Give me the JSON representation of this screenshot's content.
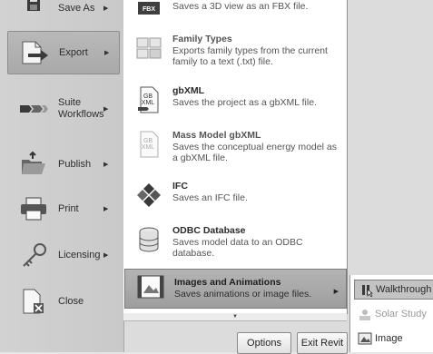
{
  "left_menu": {
    "items": [
      {
        "label": "Save As",
        "icon": "save-as-icon",
        "has_arrow": true
      },
      {
        "label": "Export",
        "icon": "export-icon",
        "has_arrow": true,
        "active": true
      },
      {
        "label": "Suite Workflows",
        "icon": "suite-workflows-icon",
        "has_arrow": true
      },
      {
        "label": "Publish",
        "icon": "publish-icon",
        "has_arrow": true
      },
      {
        "label": "Print",
        "icon": "print-icon",
        "has_arrow": true
      },
      {
        "label": "Licensing",
        "icon": "licensing-key-icon",
        "has_arrow": true
      },
      {
        "label": "Close",
        "icon": "close-document-icon",
        "has_arrow": false
      }
    ]
  },
  "export_menu": {
    "items": [
      {
        "title": "",
        "desc": "Saves a 3D view as an FBX file.",
        "icon": "fbx-icon"
      },
      {
        "title": "Family Types",
        "desc": "Exports family types from the current family to a text (.txt) file.",
        "icon": "family-types-icon"
      },
      {
        "title": "gbXML",
        "desc": "Saves the project as a gbXML file.",
        "icon": "gbxml-icon"
      },
      {
        "title": "Mass Model gbXML",
        "desc": "Saves the conceptual energy model as a gbXML file.",
        "icon": "mass-model-gbxml-icon"
      },
      {
        "title": "IFC",
        "desc": "Saves an IFC file.",
        "icon": "ifc-icon"
      },
      {
        "title": "ODBC Database",
        "desc": "Saves model data to an ODBC database.",
        "icon": "odbc-database-icon"
      },
      {
        "title": "Images and Animations",
        "desc": "Saves animations or image files.",
        "icon": "images-animations-icon",
        "highlighted": true
      }
    ],
    "fbx_badge": "FBX"
  },
  "flyout": {
    "items": [
      {
        "label": "Walkthrough",
        "icon": "walkthrough-icon",
        "highlighted": true
      },
      {
        "label": "Solar Study",
        "icon": "solar-study-icon",
        "disabled": true
      },
      {
        "label": "Image",
        "icon": "image-icon"
      }
    ]
  },
  "footer": {
    "options_label": "Options",
    "exit_label": "Exit Revit"
  },
  "colors": {
    "left_bg": "#c9c9c9",
    "panel_bg": "#ffffff",
    "highlight": "#a8a8a8"
  }
}
